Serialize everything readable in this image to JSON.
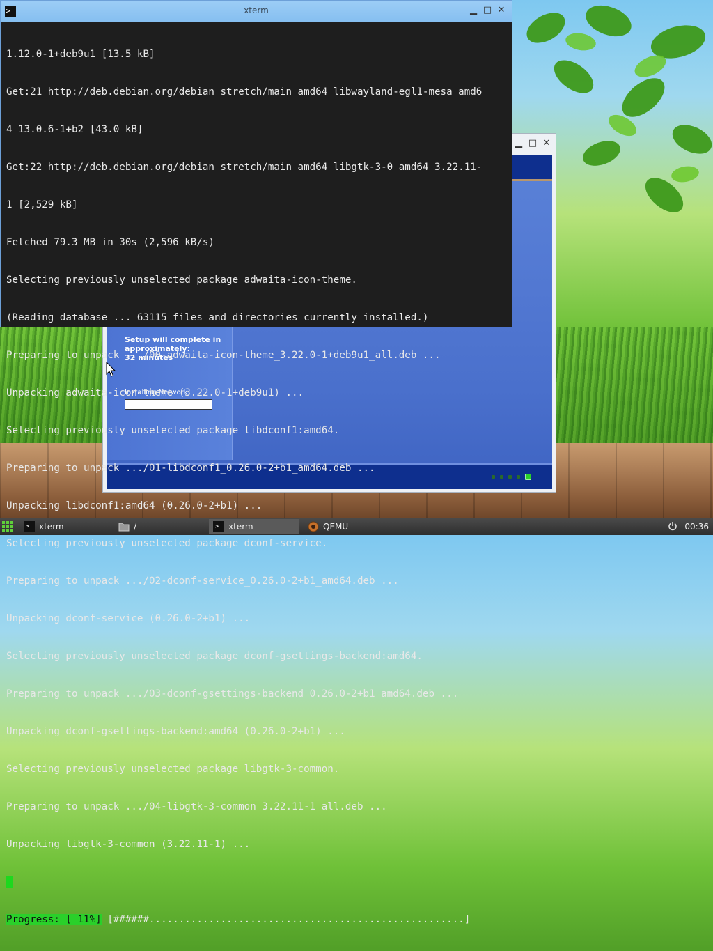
{
  "xterm": {
    "title": "xterm",
    "lines": [
      "1.12.0-1+deb9u1 [13.5 kB]",
      "Get:21 http://deb.debian.org/debian stretch/main amd64 libwayland-egl1-mesa amd6",
      "4 13.0.6-1+b2 [43.0 kB]",
      "Get:22 http://deb.debian.org/debian stretch/main amd64 libgtk-3-0 amd64 3.22.11-",
      "1 [2,529 kB]",
      "Fetched 79.3 MB in 30s (2,596 kB/s)",
      "Selecting previously unselected package adwaita-icon-theme.",
      "(Reading database ... 63115 files and directories currently installed.)",
      "Preparing to unpack .../00-adwaita-icon-theme_3.22.0-1+deb9u1_all.deb ...",
      "Unpacking adwaita-icon-theme (3.22.0-1+deb9u1) ...",
      "Selecting previously unselected package libdconf1:amd64.",
      "Preparing to unpack .../01-libdconf1_0.26.0-2+b1_amd64.deb ...",
      "Unpacking libdconf1:amd64 (0.26.0-2+b1) ...",
      "Selecting previously unselected package dconf-service.",
      "Preparing to unpack .../02-dconf-service_0.26.0-2+b1_amd64.deb ...",
      "Unpacking dconf-service (0.26.0-2+b1) ...",
      "Selecting previously unselected package dconf-gsettings-backend:amd64.",
      "Preparing to unpack .../03-dconf-gsettings-backend_0.26.0-2+b1_amd64.deb ...",
      "Unpacking dconf-gsettings-backend:amd64 (0.26.0-2+b1) ...",
      "Selecting previously unselected package libgtk-3-common.",
      "Preparing to unpack .../04-libgtk-3-common_3.22.11-1_all.deb ...",
      "Unpacking libgtk-3-common (3.22.11-1) ..."
    ],
    "progress_label": "Progress: [ 11%]",
    "progress_bar": " [######.....................................................]"
  },
  "qemu": {
    "setup_text": "Setup will complete in\napproximately:\n      32 minutes",
    "install_label": "Installing Network",
    "install_progress": 0,
    "dots_active_index": 4
  },
  "taskbar": {
    "items": [
      {
        "label": "xterm",
        "icon": "terminal-icon"
      },
      {
        "label": "/",
        "icon": "folder-icon"
      },
      {
        "label": "xterm",
        "icon": "terminal-icon"
      },
      {
        "label": "QEMU",
        "icon": "qemu-icon"
      }
    ],
    "clock": "00:36"
  },
  "colors": {
    "terminal_bg": "#1e1e1e",
    "progress_green": "#2ad02a",
    "xp_blue": "#0e2f8e"
  }
}
